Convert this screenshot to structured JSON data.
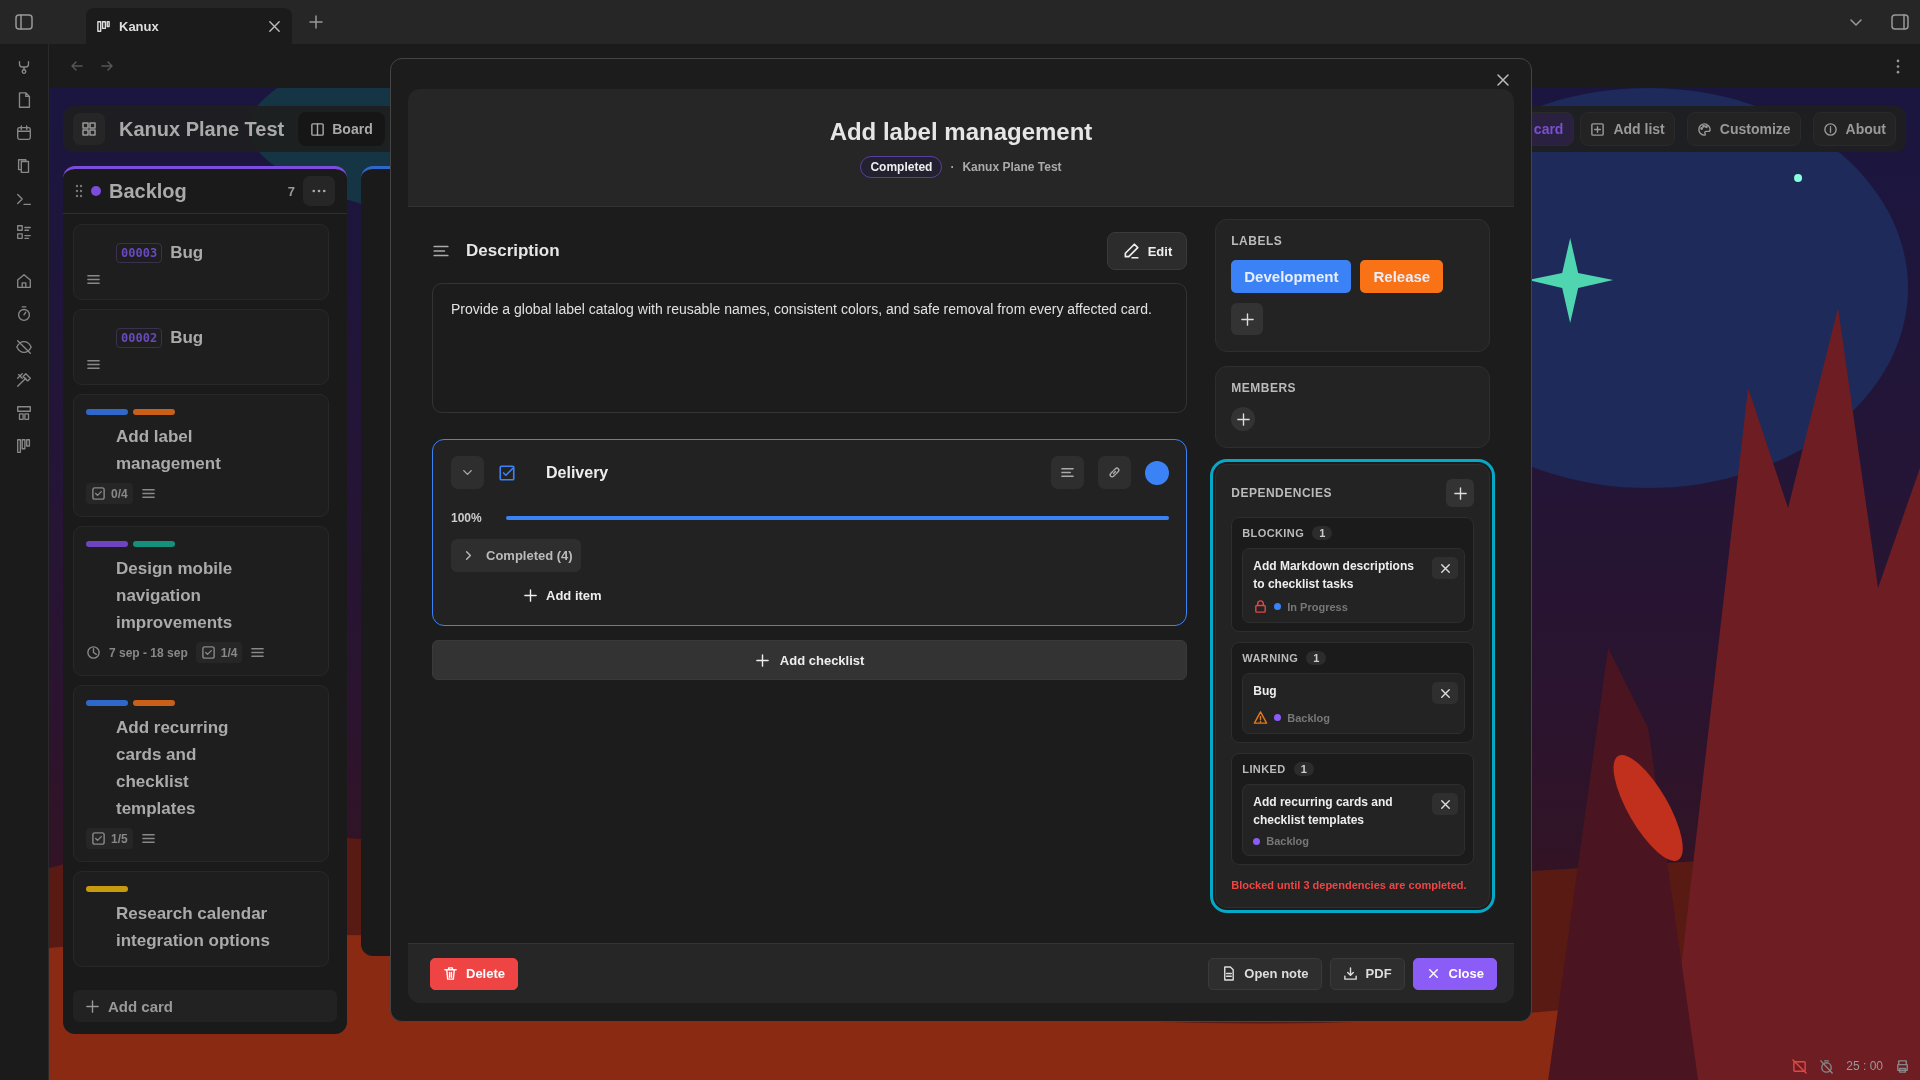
{
  "app_tabs": [
    {
      "label": "Kanux",
      "selected": true
    }
  ],
  "board": {
    "title": "Kanux Plane Test",
    "view_button": "Board",
    "actions": [
      {
        "label": "card",
        "kind": "primary"
      },
      {
        "label": "Add list",
        "kind": "add"
      },
      {
        "label": "Customize",
        "kind": "palette"
      },
      {
        "label": "About",
        "kind": "info"
      }
    ]
  },
  "column": {
    "title": "Backlog",
    "color": "#7c4ddc",
    "count": "7",
    "add_card": "Add card",
    "cards": [
      {
        "id": "00003",
        "title": "Bug",
        "has_description": true
      },
      {
        "id": "00002",
        "title": "Bug",
        "has_description": true
      },
      {
        "title": "Add label management",
        "labels": [
          {
            "color": "#2f68c8"
          },
          {
            "color": "#c8601a"
          }
        ],
        "checklist": "0/4",
        "has_description": true
      },
      {
        "title": "Design mobile navigation improvements",
        "labels": [
          {
            "color": "#6e44c0"
          },
          {
            "color": "#14907c"
          }
        ],
        "date": "7 sep - 18 sep",
        "checklist": "1/4",
        "has_description": true
      },
      {
        "title": "Add recurring cards and checklist templates",
        "labels": [
          {
            "color": "#2f68c8"
          },
          {
            "color": "#c8601a"
          }
        ],
        "checklist": "1/5",
        "has_description": true
      },
      {
        "title": "Research calendar integration options",
        "labels": [
          {
            "color": "#c89a10"
          }
        ]
      }
    ]
  },
  "modal": {
    "title": "Add label management",
    "status": "Completed",
    "separator": "·",
    "board": "Kanux Plane Test",
    "description": {
      "heading": "Description",
      "edit": "Edit",
      "text": "Provide a global label catalog with reusable names, consistent colors, and safe removal from every affected card."
    },
    "checklists": [
      {
        "title": "Delivery",
        "color": "#3b82f6",
        "level": 1,
        "percent": "100%",
        "completed": "Completed (4)",
        "expanded": false,
        "add_item": "Add item"
      }
    ],
    "add_checklist": "Add checklist",
    "labels": {
      "heading": "LABELS",
      "items": [
        {
          "name": "Development",
          "color": "#3b82f6"
        },
        {
          "name": "Release",
          "color": "#f97316"
        }
      ]
    },
    "members": {
      "heading": "MEMBERS"
    },
    "dependencies": {
      "heading": "DEPENDENCIES",
      "highlighted": true,
      "groups": [
        {
          "kind": "blocking",
          "title": "BLOCKING",
          "count": "1",
          "items": [
            {
              "title": "Add Markdown descriptions to checklist tasks",
              "status": "In Progress",
              "color": "#3b82f6"
            }
          ]
        },
        {
          "kind": "warning",
          "title": "WARNING",
          "count": "1",
          "items": [
            {
              "title": "Bug",
              "status": "Backlog",
              "color": "#8b5cf6"
            }
          ]
        },
        {
          "kind": "linked",
          "title": "LINKED",
          "count": "1",
          "items": [
            {
              "title": "Add recurring cards and checklist templates",
              "status": "Backlog",
              "color": "#8b5cf6"
            }
          ]
        }
      ],
      "notice": "Blocked until 3 dependencies are completed."
    },
    "footer": {
      "delete": "Delete",
      "open_note": "Open note",
      "pdf": "PDF",
      "close": "Close"
    }
  },
  "status_bar": {
    "timer": "25 : 00"
  }
}
